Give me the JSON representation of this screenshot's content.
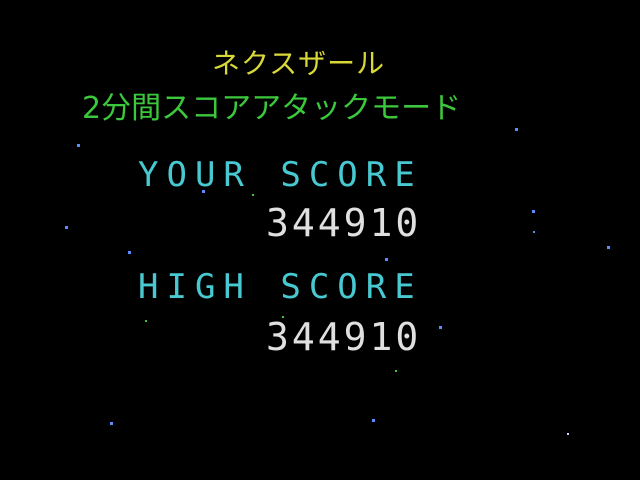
{
  "title": "ネクスザール",
  "subtitle": "2分間スコアアタックモード",
  "your_score": {
    "label": "YOUR SCORE",
    "value": "344910"
  },
  "high_score": {
    "label": "HIGH SCORE",
    "value": "344910"
  },
  "colors": {
    "background": "#000000",
    "title": "#d8d838",
    "subtitle": "#3cc83c",
    "score_label": "#48c8d0",
    "score_value": "#e0e0e0",
    "star_blue": "#5a8cff",
    "star_green": "#3cc83c",
    "star_white": "#d0d0ff"
  }
}
